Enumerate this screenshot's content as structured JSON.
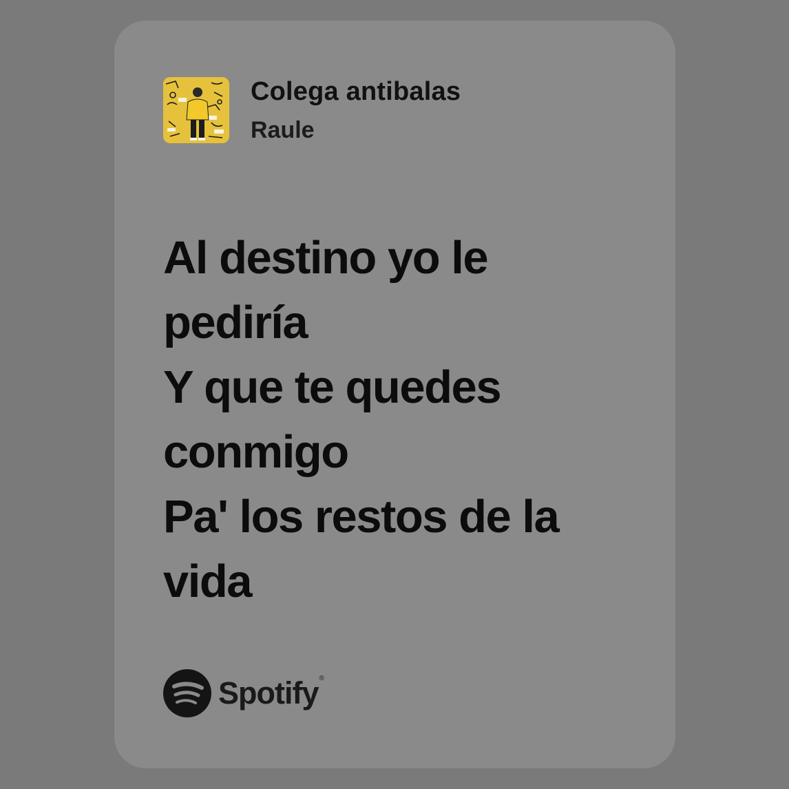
{
  "track": {
    "title": "Colega antibalas",
    "artist": "Raule",
    "cover_icon": "album-cover-art"
  },
  "lyrics": {
    "lines": [
      "Al destino yo le",
      "pediría",
      "Y que te quedes",
      "conmigo",
      "Pa' los restos de la",
      "vida"
    ]
  },
  "brand": {
    "name": "Spotify",
    "icon": "spotify-logo-icon"
  },
  "colors": {
    "page_background": "#7a7a7a",
    "card_background": "#8a8a8a",
    "text": "#0c0c0c",
    "cover_yellow": "#e8c33a"
  }
}
